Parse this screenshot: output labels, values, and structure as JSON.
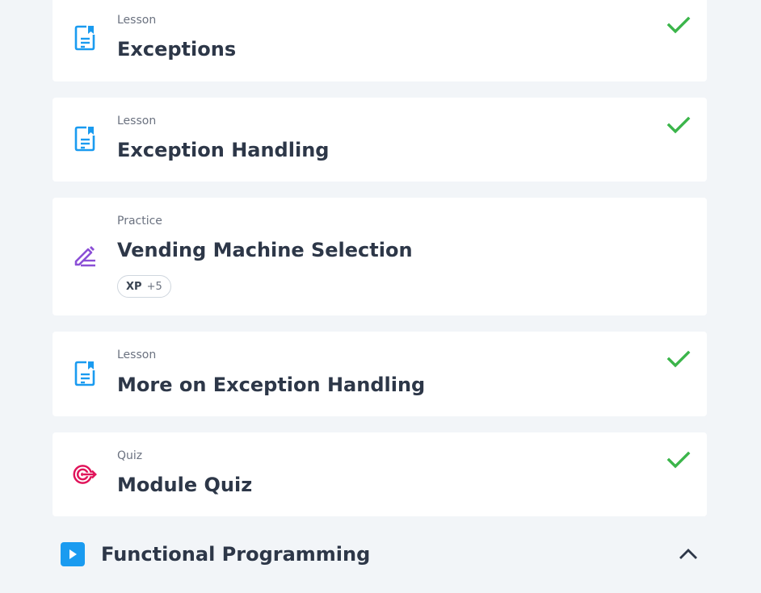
{
  "items": [
    {
      "type": "Lesson",
      "title": "Exceptions",
      "completed": true,
      "icon": "lesson-icon"
    },
    {
      "type": "Lesson",
      "title": "Exception Handling",
      "completed": true,
      "icon": "lesson-icon"
    },
    {
      "type": "Practice",
      "title": "Vending Machine Selection",
      "completed": false,
      "icon": "practice-pencil-icon",
      "xp_label": "XP",
      "xp_value": "+5"
    },
    {
      "type": "Lesson",
      "title": "More on Exception Handling",
      "completed": true,
      "icon": "lesson-icon"
    },
    {
      "type": "Quiz",
      "title": "Module Quiz",
      "completed": true,
      "icon": "quiz-target-icon"
    }
  ],
  "next_section": {
    "title": "Functional Programming",
    "icon": "play-icon",
    "toggle_icon": "chevron-up-icon"
  },
  "colors": {
    "background": "#f2f5f8",
    "card": "#ffffff",
    "lesson_icon": "#1a9bf0",
    "practice_icon": "#8b4fd6",
    "quiz_icon": "#e0145a",
    "check": "#3bb54a",
    "title_text": "#2d3748",
    "type_text": "#6b7280"
  }
}
